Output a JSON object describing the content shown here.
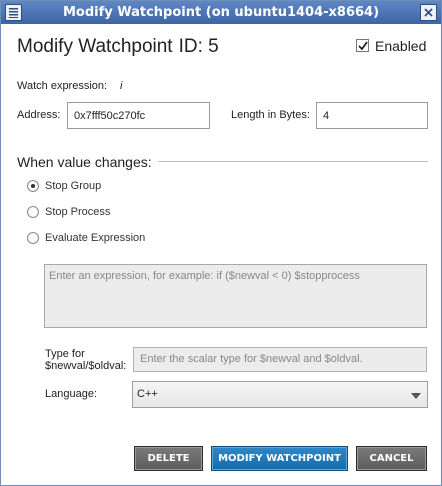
{
  "window": {
    "title": "Modify Watchpoint (on ubuntu1404-x8664)",
    "menu_icon": "window-menu-icon",
    "close_icon": "close-icon"
  },
  "header": {
    "title": "Modify Watchpoint",
    "id_label": "ID: 5",
    "enabled_label": "Enabled",
    "enabled_checked": true
  },
  "watch": {
    "expression_label": "Watch expression:",
    "expression_value": "i",
    "address_label": "Address:",
    "address_value": "0x7fff50c270fc",
    "length_label": "Length in Bytes:",
    "length_value": "4"
  },
  "changes": {
    "section_title": "When value changes:",
    "options": [
      {
        "label": "Stop Group",
        "selected": true
      },
      {
        "label": "Stop Process",
        "selected": false
      },
      {
        "label": "Evaluate Expression",
        "selected": false
      }
    ],
    "expression_placeholder": "Enter an expression, for example:   if ($newval < 0) $stopprocess",
    "type_label_line1": "Type for",
    "type_label_line2": "$newval/$oldval:",
    "type_placeholder": "Enter the scalar type for $newval and $oldval.",
    "language_label": "Language:",
    "language_value": "C++"
  },
  "buttons": {
    "delete": "DELETE",
    "modify": "MODIFY WATCHPOINT",
    "cancel": "CANCEL"
  },
  "colors": {
    "titlebar": "#4a72b4",
    "primary_button": "#1f78bb",
    "grey_button": "#6b6b6b"
  }
}
